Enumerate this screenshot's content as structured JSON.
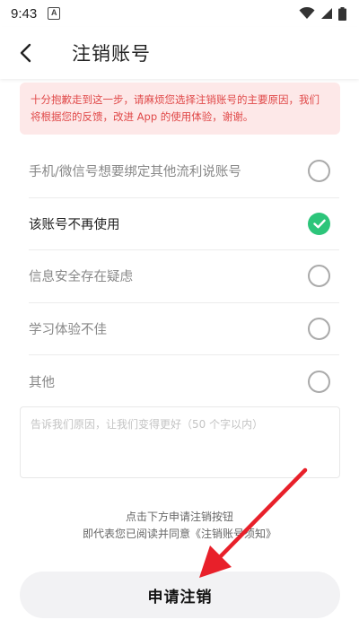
{
  "status_bar": {
    "time": "9:43",
    "notification_glyph": "A"
  },
  "header": {
    "title": "注销账号"
  },
  "notice": {
    "text": "十分抱歉走到这一步，请麻烦您选择注销账号的主要原因，我们将根据您的反馈，改进 App 的使用体验，谢谢。",
    "color": "#e04848",
    "background": "#fde8e8"
  },
  "reasons": [
    {
      "label": "手机/微信号想要绑定其他流利说账号",
      "selected": false
    },
    {
      "label": "该账号不再使用",
      "selected": true
    },
    {
      "label": "信息安全存在疑虑",
      "selected": false
    },
    {
      "label": "学习体验不佳",
      "selected": false
    },
    {
      "label": "其他",
      "selected": false
    }
  ],
  "feedback": {
    "placeholder": "告诉我们原因，让我们变得更好（50 个字以内）"
  },
  "footer": {
    "line1": "点击下方申请注销按钮",
    "line2": "即代表您已阅读并同意《注销账号须知》"
  },
  "submit": {
    "label": "申请注销"
  },
  "colors": {
    "check_green": "#2cc57a",
    "arrow_red": "#e8202a"
  },
  "icons": [
    "wifi-icon",
    "signal-icon",
    "battery-icon",
    "back-arrow-icon",
    "check-icon",
    "annotation-arrow"
  ]
}
